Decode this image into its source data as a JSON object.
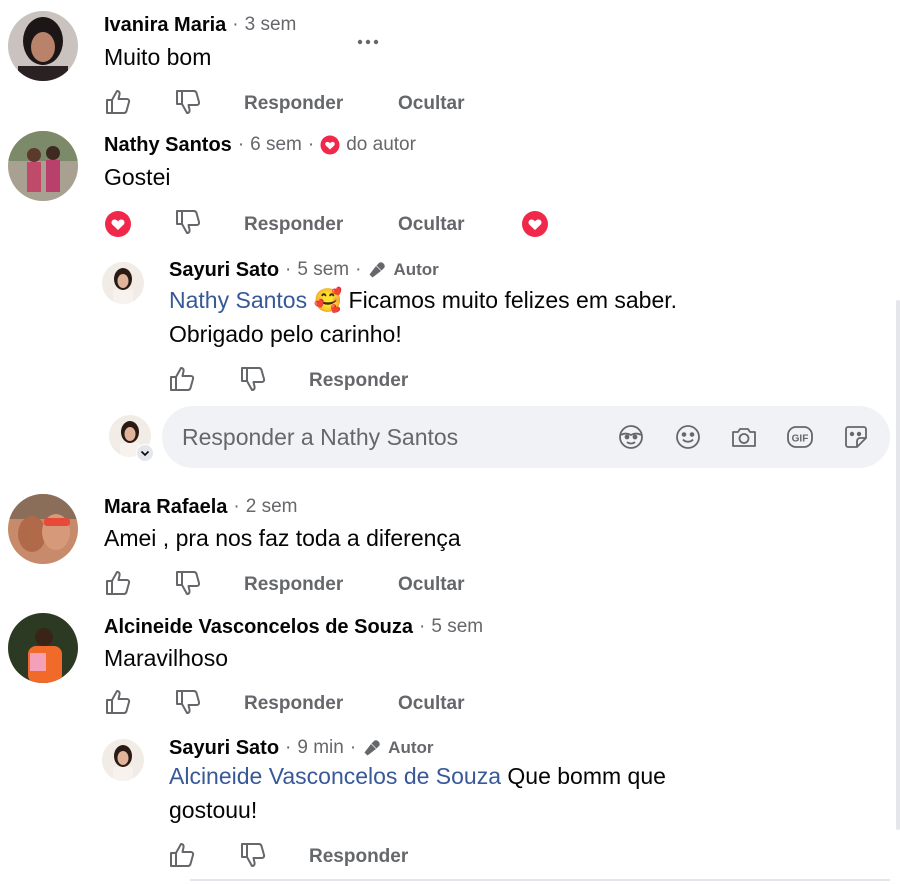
{
  "comments": [
    {
      "author": "Ivanira Maria",
      "time": "3 sem",
      "text": "Muito bom",
      "actions": {
        "reply": "Responder",
        "hide": "Ocultar"
      },
      "more": "..."
    },
    {
      "author": "Nathy Santos",
      "time": "6 sem",
      "badge": "do autor",
      "text": "Gostei",
      "actions": {
        "reply": "Responder",
        "hide": "Ocultar"
      },
      "replies": [
        {
          "author": "Sayuri Sato",
          "time": "5 sem",
          "role": "Autor",
          "mention": "Nathy Santos",
          "emoji": "🥰",
          "text_line1": "Ficamos muito felizes em saber.",
          "text_line2": "Obrigado pelo carinho!",
          "actions": {
            "reply": "Responder"
          }
        }
      ],
      "reply_input_placeholder": "Responder a Nathy Santos"
    },
    {
      "author": "Mara Rafaela",
      "time": "2 sem",
      "text": "Amei , pra nos faz toda a diferença",
      "actions": {
        "reply": "Responder",
        "hide": "Ocultar"
      }
    },
    {
      "author": "Alcineide Vasconcelos de Souza",
      "time": "5 sem",
      "text": "Maravilhoso",
      "actions": {
        "reply": "Responder",
        "hide": "Ocultar"
      },
      "replies": [
        {
          "author": "Sayuri Sato",
          "time": "9 min",
          "role": "Autor",
          "mention": "Alcineide Vasconcelos de Souza",
          "text_line1": "Que bomm que",
          "text_line2": "gostouu!",
          "actions": {
            "reply": "Responder"
          }
        }
      ]
    }
  ],
  "separator": "·",
  "colors": {
    "mention": "#385898",
    "heart": "#f02849",
    "secondary": "#65676b"
  }
}
